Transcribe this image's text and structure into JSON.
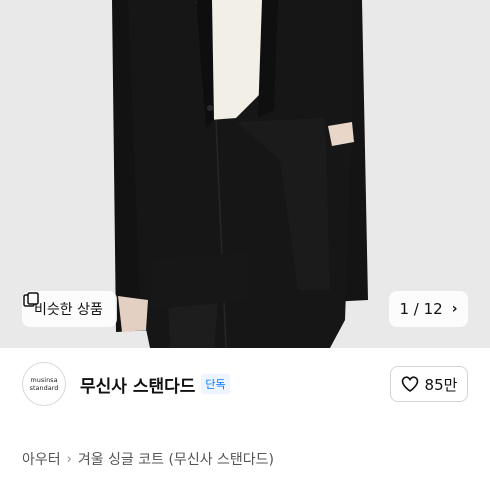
{
  "image": {
    "similar_button_label": "비슷한 상품",
    "pager": {
      "current": "1",
      "separator": "/",
      "total": "12"
    }
  },
  "brand": {
    "logo_text_1": "musinsa",
    "logo_text_2": "standard",
    "name": "무신사 스탠다드",
    "badge": "단독",
    "likes": "85만"
  },
  "breadcrumb": {
    "category": "아우터",
    "product": "겨울 싱글 코트 (무신사 스탠다드)"
  },
  "colors": {
    "accent": "#0078ff",
    "coat": "#151515",
    "sweater": "#f1efe6",
    "background": "#e9e9e9"
  }
}
